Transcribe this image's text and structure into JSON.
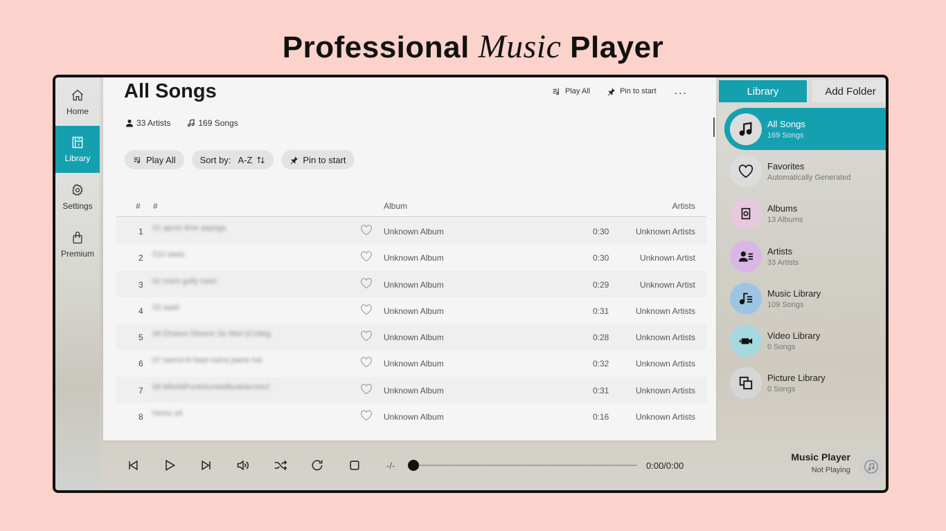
{
  "promo": {
    "part1": "Professional",
    "part2": "Music",
    "part3": "Player"
  },
  "nav": [
    {
      "label": "Home",
      "icon": "home-icon"
    },
    {
      "label": "Library",
      "icon": "library-icon"
    },
    {
      "label": "Settings",
      "icon": "gear-icon"
    },
    {
      "label": "Premium",
      "icon": "shopping-bag-icon"
    }
  ],
  "main": {
    "title": "All Songs",
    "top_actions": {
      "play_all": "Play All",
      "pin": "Pin to start",
      "more": "..."
    },
    "stats": {
      "artists": "33 Artists",
      "songs": "169 Songs"
    },
    "chips": {
      "play_all": "Play All",
      "sort_label": "Sort by:",
      "sort_value": "A-Z",
      "pin": "Pin to start"
    },
    "columns": {
      "num": "#",
      "title": "#",
      "album": "Album",
      "artists": "Artists"
    },
    "rows": [
      {
        "num": "1",
        "title": "01 aprox time aayega",
        "album": "Unknown Album",
        "duration": "0:30",
        "artist": "Unknown Artists"
      },
      {
        "num": "2",
        "title": "010 aaaa",
        "album": "Unknown Album",
        "duration": "0:30",
        "artist": "Unknown Artist"
      },
      {
        "num": "3",
        "title": "02 mere gully mein",
        "album": "Unknown Album",
        "duration": "0:29",
        "artist": "Unknown Artist"
      },
      {
        "num": "4",
        "title": "03 aaah",
        "album": "Unknown Album",
        "duration": "0:31",
        "artist": "Unknown Artists"
      },
      {
        "num": "5",
        "title": "06 Dheere Dheere Se Meri (Cndeg)",
        "album": "Unknown Album",
        "duration": "0:28",
        "artist": "Unknown Artists"
      },
      {
        "num": "6",
        "title": "07 sanna ki baat naina jaane hai",
        "album": "Unknown Album",
        "duration": "0:32",
        "artist": "Unknown Artists"
      },
      {
        "num": "7",
        "title": "08 MiloMiFunkdumbelBudeleuVocho",
        "album": "Unknown Album",
        "duration": "0:31",
        "artist": "Unknown Artists"
      },
      {
        "num": "8",
        "title": "heroo xd",
        "album": "Unknown Album",
        "duration": "0:16",
        "artist": "Unknown Artists"
      }
    ]
  },
  "right": {
    "library_button": "Library",
    "add_folder_button": "Add Folder",
    "items": [
      {
        "title": "All Songs",
        "sub": "169 Songs",
        "icon": "music-note-icon",
        "color": "#dcdcdc"
      },
      {
        "title": "Favorites",
        "sub": "Automatically Generated",
        "icon": "heart-icon",
        "color": "#dcdcdc"
      },
      {
        "title": "Albums",
        "sub": "13 Albums",
        "icon": "album-icon",
        "color": "#e6c9de"
      },
      {
        "title": "Artists",
        "sub": "33 Artists",
        "icon": "artist-icon",
        "color": "#d9b6e6"
      },
      {
        "title": "Music Library",
        "sub": "109 Songs",
        "icon": "music-list-icon",
        "color": "#9dc5e3"
      },
      {
        "title": "Video Library",
        "sub": "0 Songs",
        "icon": "video-icon",
        "color": "#a5d9e0"
      },
      {
        "title": "Picture Library",
        "sub": "0 Songs",
        "icon": "picture-icon",
        "color": "#d6d6d6"
      }
    ]
  },
  "player": {
    "time_left": "-/-",
    "time_right": "0:00/0:00",
    "progress": 0,
    "now_playing_title": "Music Player",
    "now_playing_sub": "Not Playing"
  },
  "colors": {
    "accent": "#15a0b0",
    "background": "#fcd3cc"
  }
}
